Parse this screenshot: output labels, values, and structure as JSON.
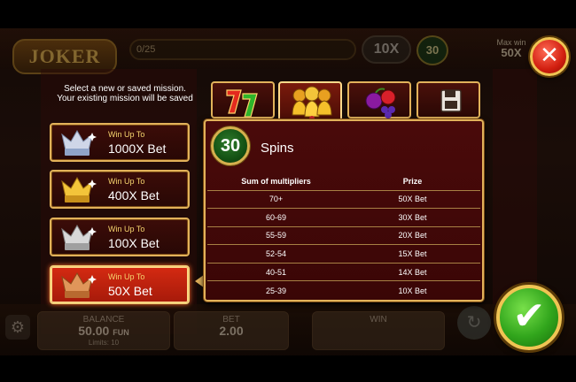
{
  "background": {
    "logo_text": "JOKER",
    "progress_text": "0/25",
    "multiplier_chip": "10X",
    "spins_chip": "30",
    "max_win_label": "Max win",
    "max_win_value": "50X",
    "balance_label": "BALANCE",
    "balance_value": "50.00",
    "balance_currency": "FUN",
    "balance_sub": "Limits: 10",
    "bet_label": "BET",
    "bet_value": "2.00",
    "win_label": "WIN"
  },
  "instruction": "Select a new or saved mission. Your existing mission will be saved",
  "missions": [
    {
      "badge": "PLATINUM",
      "label": "Win Up To",
      "value": "1000X Bet",
      "selected": false
    },
    {
      "badge": "GOLD",
      "label": "Win Up To",
      "value": "400X Bet",
      "selected": false
    },
    {
      "badge": "SILVER",
      "label": "Win Up To",
      "value": "100X Bet",
      "selected": false
    },
    {
      "badge": "BRONZE",
      "label": "Win Up To",
      "value": "50X Bet",
      "selected": true
    }
  ],
  "tabs": [
    {
      "icon": "sevens-icon",
      "active": false
    },
    {
      "icon": "bells-icon",
      "active": true
    },
    {
      "icon": "fruits-icon",
      "active": false
    },
    {
      "icon": "save-disk-icon",
      "active": false
    }
  ],
  "panel": {
    "spins_count": "30",
    "spins_label": "Spins",
    "table": {
      "headers": [
        "Sum of multipliers",
        "Prize"
      ],
      "rows": [
        [
          "70+",
          "50X Bet"
        ],
        [
          "60-69",
          "30X Bet"
        ],
        [
          "55-59",
          "20X Bet"
        ],
        [
          "52-54",
          "15X Bet"
        ],
        [
          "40-51",
          "14X Bet"
        ],
        [
          "25-39",
          "10X Bet"
        ]
      ]
    }
  },
  "colors": {
    "gold_border": "#e2b25a",
    "panel_bg": "#3a0606",
    "selected_mission": "#d42a12",
    "close_red": "#d11f10",
    "confirm_green": "#31a51c"
  },
  "icons": {
    "close": "close-icon",
    "confirm": "checkmark-icon"
  }
}
